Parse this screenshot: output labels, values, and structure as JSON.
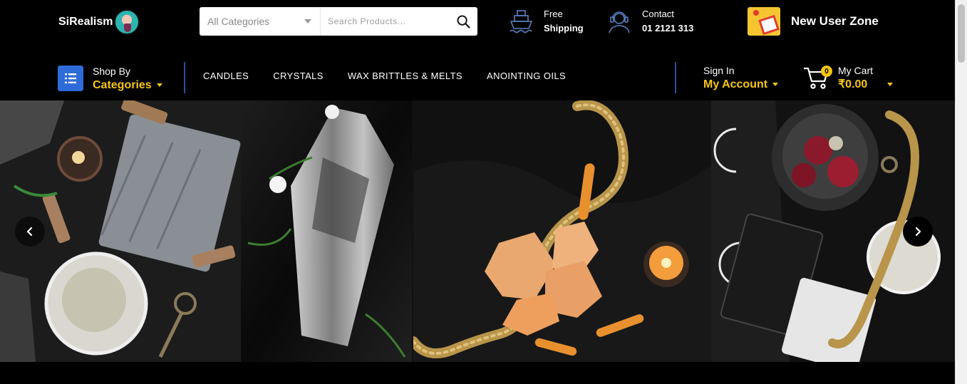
{
  "brand": {
    "name": "SiRealism"
  },
  "search": {
    "category_value": "All Categories",
    "placeholder": "Search Products..."
  },
  "shipping": {
    "line1": "Free",
    "line2": "Shipping"
  },
  "contact": {
    "line1": "Contact",
    "line2": "01 2121 313"
  },
  "new_user_zone": {
    "label": "New User Zone"
  },
  "shop_by": {
    "line1": "Shop By",
    "line2": "Categories"
  },
  "nav": {
    "links": [
      {
        "label": "CANDLES"
      },
      {
        "label": "CRYSTALS"
      },
      {
        "label": "WAX BRITTLES & MELTS"
      },
      {
        "label": "ANOINTING OILS"
      }
    ]
  },
  "account": {
    "line1": "Sign In",
    "line2": "My Account"
  },
  "cart": {
    "count": "0",
    "line1": "My Cart",
    "line2": "₹0.00"
  },
  "colors": {
    "accent": "#f5c518",
    "nav_divider": "#2d4f9a",
    "shop_icon_bg": "#2f6bd8",
    "background": "#000000"
  },
  "icons": {
    "search": "search-icon",
    "shipping": "ship-icon",
    "contact": "headset-icon",
    "new_user": "gift-icon",
    "shop_by": "list-icon",
    "cart": "cart-icon",
    "prev": "chevron-left-icon",
    "next": "chevron-right-icon"
  }
}
